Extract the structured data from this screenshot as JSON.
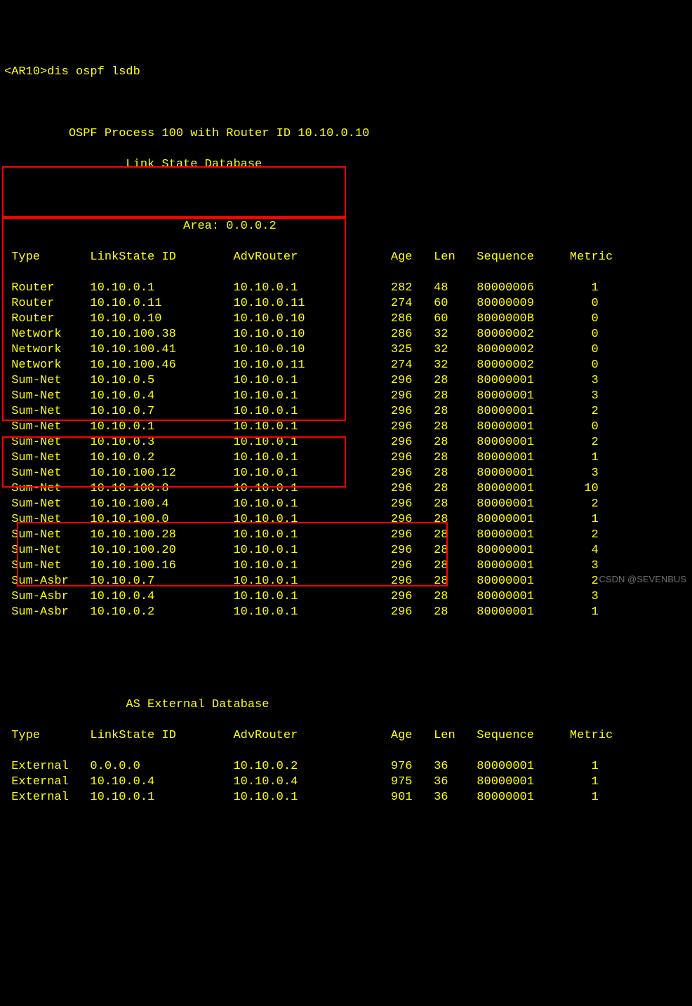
{
  "prompt": "<AR10>dis ospf lsdb",
  "header1": "         OSPF Process 100 with Router ID 10.10.0.10",
  "header2": "                 Link State Database",
  "area_line": "                         Area: 0.0.0.2",
  "columns": {
    "type": "Type",
    "lsid": "LinkState ID",
    "advr": "AdvRouter",
    "age": "Age",
    "len": "Len",
    "seq": "Sequence",
    "metric": "Metric"
  },
  "rows": [
    {
      "t": "Router",
      "ls": "10.10.0.1",
      "a": "10.10.0.1",
      "age": "282",
      "len": "48",
      "seq": "80000006",
      "m": "1"
    },
    {
      "t": "Router",
      "ls": "10.10.0.11",
      "a": "10.10.0.11",
      "age": "274",
      "len": "60",
      "seq": "80000009",
      "m": "0"
    },
    {
      "t": "Router",
      "ls": "10.10.0.10",
      "a": "10.10.0.10",
      "age": "286",
      "len": "60",
      "seq": "8000000B",
      "m": "0"
    },
    {
      "t": "Network",
      "ls": "10.10.100.38",
      "a": "10.10.0.10",
      "age": "286",
      "len": "32",
      "seq": "80000002",
      "m": "0"
    },
    {
      "t": "Network",
      "ls": "10.10.100.41",
      "a": "10.10.0.10",
      "age": "325",
      "len": "32",
      "seq": "80000002",
      "m": "0"
    },
    {
      "t": "Network",
      "ls": "10.10.100.46",
      "a": "10.10.0.11",
      "age": "274",
      "len": "32",
      "seq": "80000002",
      "m": "0"
    },
    {
      "t": "Sum-Net",
      "ls": "10.10.0.5",
      "a": "10.10.0.1",
      "age": "296",
      "len": "28",
      "seq": "80000001",
      "m": "3"
    },
    {
      "t": "Sum-Net",
      "ls": "10.10.0.4",
      "a": "10.10.0.1",
      "age": "296",
      "len": "28",
      "seq": "80000001",
      "m": "3"
    },
    {
      "t": "Sum-Net",
      "ls": "10.10.0.7",
      "a": "10.10.0.1",
      "age": "296",
      "len": "28",
      "seq": "80000001",
      "m": "2"
    },
    {
      "t": "Sum-Net",
      "ls": "10.10.0.1",
      "a": "10.10.0.1",
      "age": "296",
      "len": "28",
      "seq": "80000001",
      "m": "0"
    },
    {
      "t": "Sum-Net",
      "ls": "10.10.0.3",
      "a": "10.10.0.1",
      "age": "296",
      "len": "28",
      "seq": "80000001",
      "m": "2"
    },
    {
      "t": "Sum-Net",
      "ls": "10.10.0.2",
      "a": "10.10.0.1",
      "age": "296",
      "len": "28",
      "seq": "80000001",
      "m": "1"
    },
    {
      "t": "Sum-Net",
      "ls": "10.10.100.12",
      "a": "10.10.0.1",
      "age": "296",
      "len": "28",
      "seq": "80000001",
      "m": "3"
    },
    {
      "t": "Sum-Net",
      "ls": "10.10.100.8",
      "a": "10.10.0.1",
      "age": "296",
      "len": "28",
      "seq": "80000001",
      "m": "10"
    },
    {
      "t": "Sum-Net",
      "ls": "10.10.100.4",
      "a": "10.10.0.1",
      "age": "296",
      "len": "28",
      "seq": "80000001",
      "m": "2"
    },
    {
      "t": "Sum-Net",
      "ls": "10.10.100.0",
      "a": "10.10.0.1",
      "age": "296",
      "len": "28",
      "seq": "80000001",
      "m": "1"
    },
    {
      "t": "Sum-Net",
      "ls": "10.10.100.28",
      "a": "10.10.0.1",
      "age": "296",
      "len": "28",
      "seq": "80000001",
      "m": "2"
    },
    {
      "t": "Sum-Net",
      "ls": "10.10.100.20",
      "a": "10.10.0.1",
      "age": "296",
      "len": "28",
      "seq": "80000001",
      "m": "4"
    },
    {
      "t": "Sum-Net",
      "ls": "10.10.100.16",
      "a": "10.10.0.1",
      "age": "296",
      "len": "28",
      "seq": "80000001",
      "m": "3"
    },
    {
      "t": "Sum-Asbr",
      "ls": "10.10.0.7",
      "a": "10.10.0.1",
      "age": "296",
      "len": "28",
      "seq": "80000001",
      "m": "2"
    },
    {
      "t": "Sum-Asbr",
      "ls": "10.10.0.4",
      "a": "10.10.0.1",
      "age": "296",
      "len": "28",
      "seq": "80000001",
      "m": "3"
    },
    {
      "t": "Sum-Asbr",
      "ls": "10.10.0.2",
      "a": "10.10.0.1",
      "age": "296",
      "len": "28",
      "seq": "80000001",
      "m": "1"
    }
  ],
  "ext_header": "                 AS External Database",
  "ext_rows": [
    {
      "t": "External",
      "ls": "0.0.0.0",
      "a": "10.10.0.2",
      "age": "976",
      "len": "36",
      "seq": "80000001",
      "m": "1"
    },
    {
      "t": "External",
      "ls": "10.10.0.4",
      "a": "10.10.0.4",
      "age": "975",
      "len": "36",
      "seq": "80000001",
      "m": "1"
    },
    {
      "t": "External",
      "ls": "10.10.0.1",
      "a": "10.10.0.1",
      "age": "901",
      "len": "36",
      "seq": "80000001",
      "m": "1"
    }
  ],
  "watermark": "CSDN @SEVENBUS"
}
